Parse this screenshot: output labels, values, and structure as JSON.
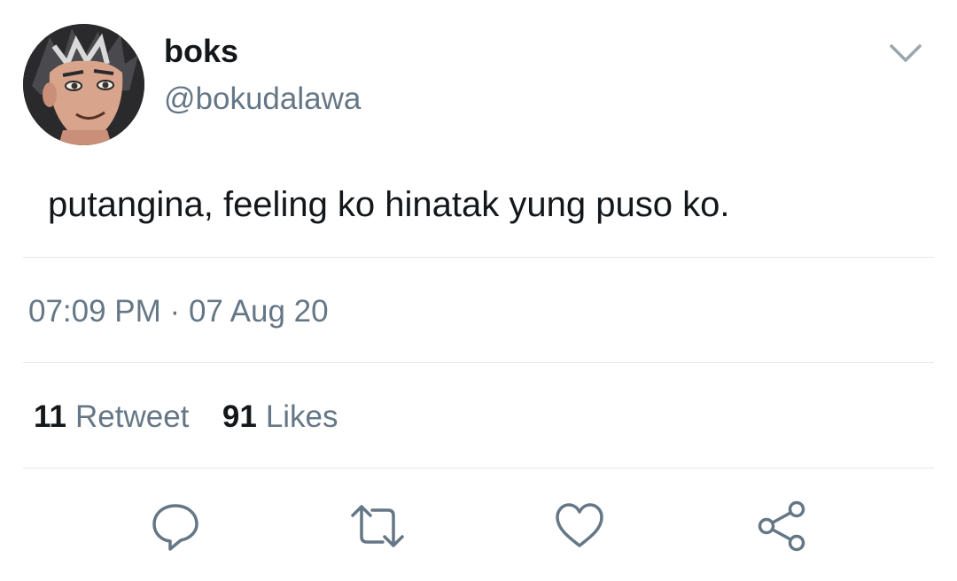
{
  "tweet": {
    "display_name": "boks",
    "handle": "@bokudalawa",
    "text": "putangina, feeling ko hinatak yung puso ko.",
    "time": "07:09 PM",
    "separator": "·",
    "date": "07 Aug 20",
    "retweet_count": "11",
    "retweet_label": "Retweet",
    "like_count": "91",
    "like_label": "Likes"
  },
  "icons": {
    "menu": "chevron-down-icon",
    "reply": "reply-icon",
    "retweet": "retweet-icon",
    "like": "heart-icon",
    "share": "share-icon"
  },
  "colors": {
    "text_primary": "#14171a",
    "text_secondary": "#657786",
    "icon": "#657786",
    "divider": "#e1e8ed"
  }
}
